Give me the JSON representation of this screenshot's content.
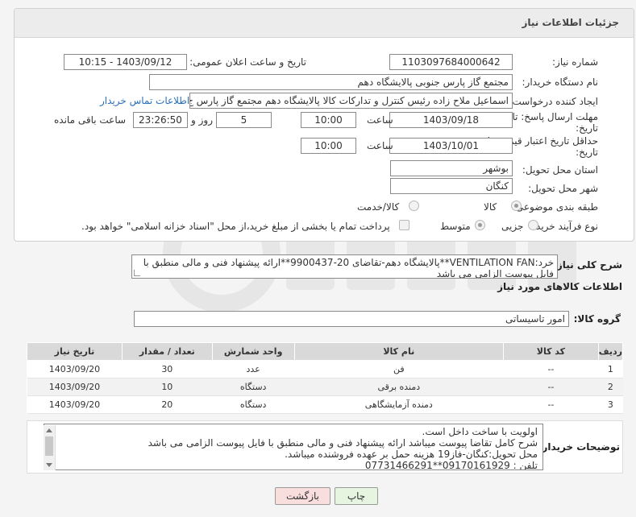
{
  "page": {
    "title": "جزئیات اطلاعات نیاز"
  },
  "form": {
    "need_number_label": "شماره نیاز:",
    "need_number": "1103097684000642",
    "announce_label": "تاریخ و ساعت اعلان عمومی:",
    "announce_value": "1403/09/12 - 10:15",
    "buyer_org_label": "نام دستگاه خریدار:",
    "buyer_org": "مجتمع گاز پارس جنوبی  پالایشگاه دهم",
    "requester_label": "ایجاد کننده درخواست:",
    "requester": "اسماعیل ملاح زاده رئیس کنترل و تدارکات کالا پالایشگاه دهم مجتمع گاز پارس ج",
    "contact_link": "اطلاعات تماس خریدار",
    "deadline_label_1": "مهلت ارسال پاسخ: تا",
    "deadline_label_2": "تاریخ:",
    "deadline_date": "1403/09/18",
    "time_label": "ساعت",
    "deadline_time": "10:00",
    "day_label": "روز و",
    "days_value": "5",
    "remaining_time": "23:26:50",
    "remaining_label": "ساعت باقی مانده",
    "validity_label_1": "حداقل تاریخ اعتبار قیمت: تا",
    "validity_label_2": "تاریخ:",
    "validity_date": "1403/10/01",
    "validity_time": "10:00",
    "province_label": "استان محل تحویل:",
    "province": "بوشهر",
    "city_label": "شهر محل تحویل:",
    "city": "کنگان",
    "category_label": "طبقه بندی موضوعی:",
    "category_goods": "کالا",
    "category_service": "کالا/خدمت",
    "process_label": "نوع فرآیند خرید :",
    "process_partial": "جزیی",
    "process_medium": "متوسط",
    "payment_note": "پرداخت تمام یا بخشی از مبلغ خرید،از محل \"اسناد خزانه اسلامی\" خواهد بود."
  },
  "description": {
    "label": "شرح کلی نیاز:",
    "text": "خرد:VENTILATION FAN**پالایشگاه دهم-تقاضای 20-9900437**ارائه پیشنهاد فنی و مالی منطبق با فایل پیوست الزامی می باشد"
  },
  "goods_info": {
    "heading": "اطلاعات کالاهای مورد نیاز",
    "group_label": "گروه کالا:",
    "group_value": "امور تاسیساتی"
  },
  "table": {
    "headers": [
      "ردیف",
      "کد کالا",
      "نام کالا",
      "واحد شمارش",
      "تعداد / مقدار",
      "تاریخ نیاز"
    ],
    "rows": [
      [
        "1",
        "--",
        "فن",
        "عدد",
        "30",
        "1403/09/20"
      ],
      [
        "2",
        "--",
        "دمنده برقی",
        "دستگاه",
        "10",
        "1403/09/20"
      ],
      [
        "3",
        "--",
        "دمنده آزمایشگاهی",
        "دستگاه",
        "20",
        "1403/09/20"
      ]
    ]
  },
  "buyer_notes": {
    "label": "توضیحات خریدار:",
    "lines": [
      "اولویت با ساخت داخل است.",
      "شرح کامل تقاضا پیوست میباشد ارائه پیشنهاد فنی و مالی منطبق با فایل پیوست الزامی می باشد",
      "محل تحویل:کنگان-فاز19 هزینه حمل بر عهده فروشنده میباشد.",
      "تلفن : 09170161929**07731466291"
    ]
  },
  "buttons": {
    "print": "چاپ",
    "back": "بازگشت"
  },
  "colors": {
    "link": "#2a6fb8",
    "print_bg": "#e6f5e0",
    "back_bg": "#f9dede"
  }
}
